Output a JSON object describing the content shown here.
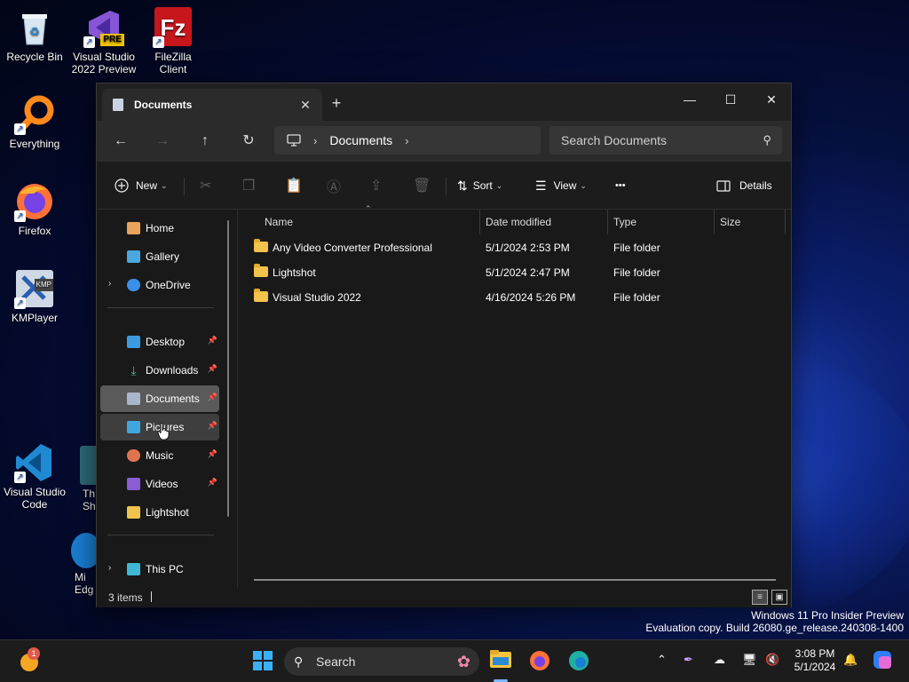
{
  "desktop": {
    "icons": [
      {
        "label": "Recycle Bin"
      },
      {
        "label": "Visual Studio 2022 Preview",
        "badge": "PRE"
      },
      {
        "label": "FileZilla Client"
      },
      {
        "label": "Everything"
      },
      {
        "label": "Firefox"
      },
      {
        "label": "KMPlayer",
        "badge": "KMP"
      },
      {
        "label": "Visual Studio Code"
      },
      {
        "label": "Th Sh"
      },
      {
        "label": "Mi Edg"
      }
    ],
    "watermark": {
      "line1": "Windows 11 Pro Insider Preview",
      "line2": "Evaluation copy. Build 26080.ge_release.240308-1400"
    }
  },
  "explorer": {
    "tab": {
      "title": "Documents",
      "close": "✕",
      "new_tab": "+"
    },
    "window_controls": {
      "minimize": "—",
      "maximize": "☐",
      "close": "✕"
    },
    "nav": {
      "back": "←",
      "forward": "→",
      "up": "↑",
      "refresh": "↻"
    },
    "address": {
      "segments": [
        "Documents"
      ],
      "sep": "›"
    },
    "search": {
      "placeholder": "Search Documents"
    },
    "toolbar": {
      "new_label": "New",
      "sort_label": "Sort",
      "view_label": "View",
      "more_label": "•••",
      "details_label": "Details"
    },
    "sidebar": {
      "items": [
        {
          "label": "Home",
          "icon": "home-icon",
          "color": "#e8a35c"
        },
        {
          "label": "Gallery",
          "icon": "gallery-icon",
          "color": "#4aa8e0"
        },
        {
          "label": "OneDrive",
          "icon": "cloud-icon",
          "color": "#3b8fe8"
        },
        {
          "label": "Desktop",
          "icon": "desktop-icon",
          "color": "#3b9be0"
        },
        {
          "label": "Downloads",
          "icon": "download-icon",
          "color": "#3fbf8a"
        },
        {
          "label": "Documents",
          "icon": "document-icon",
          "color": "#a9b7cc"
        },
        {
          "label": "Pictures",
          "icon": "pictures-icon",
          "color": "#3fa6de"
        },
        {
          "label": "Music",
          "icon": "music-icon",
          "color": "#e0734f"
        },
        {
          "label": "Videos",
          "icon": "video-icon",
          "color": "#8a5cd6"
        },
        {
          "label": "Lightshot",
          "icon": "folder-icon",
          "color": "#f1c24c"
        },
        {
          "label": "This PC",
          "icon": "pc-icon",
          "color": "#3fb8d6"
        }
      ]
    },
    "columns": [
      "Name",
      "Date modified",
      "Type",
      "Size"
    ],
    "files": [
      {
        "name": "Any Video Converter Professional",
        "date": "5/1/2024 2:53 PM",
        "type": "File folder"
      },
      {
        "name": "Lightshot",
        "date": "5/1/2024 2:47 PM",
        "type": "File folder"
      },
      {
        "name": "Visual Studio 2022",
        "date": "4/16/2024 5:26 PM",
        "type": "File folder"
      }
    ],
    "status": {
      "count": "3 items"
    }
  },
  "taskbar": {
    "search_label": "Search",
    "clock_time": "3:08 PM",
    "clock_date": "5/1/2024",
    "notification_badge": "1"
  }
}
